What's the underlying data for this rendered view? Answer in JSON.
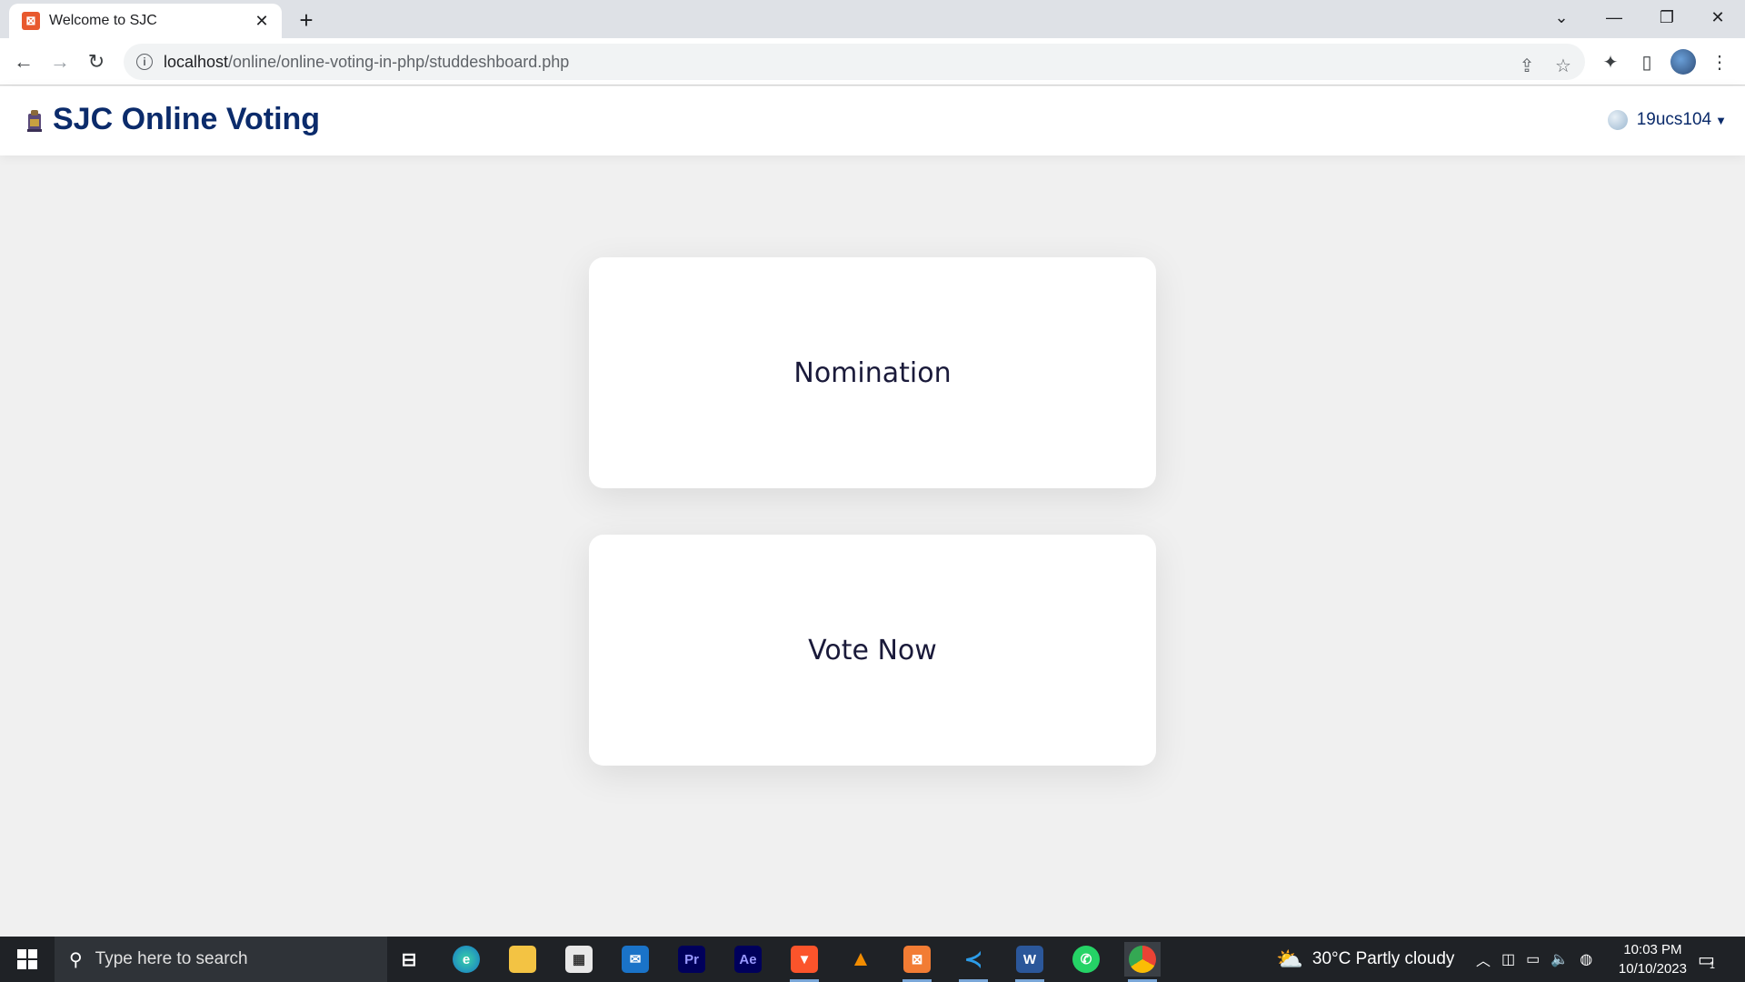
{
  "browser": {
    "tab_title": "Welcome to SJC",
    "url_host": "localhost",
    "url_path": "/online/online-voting-in-php/studdeshboard.php"
  },
  "navbar": {
    "brand": "SJC Online Voting",
    "username": "19ucs104"
  },
  "cards": {
    "nomination": "Nomination",
    "vote_now": "Vote Now"
  },
  "taskbar": {
    "search_placeholder": "Type here to search",
    "weather": "30°C  Partly cloudy",
    "time": "10:03 PM",
    "date": "10/10/2023",
    "notification_count": "1"
  },
  "colors": {
    "brand": "#0b2b6b",
    "page_bg": "#f0f0f0",
    "card_bg": "#ffffff"
  }
}
